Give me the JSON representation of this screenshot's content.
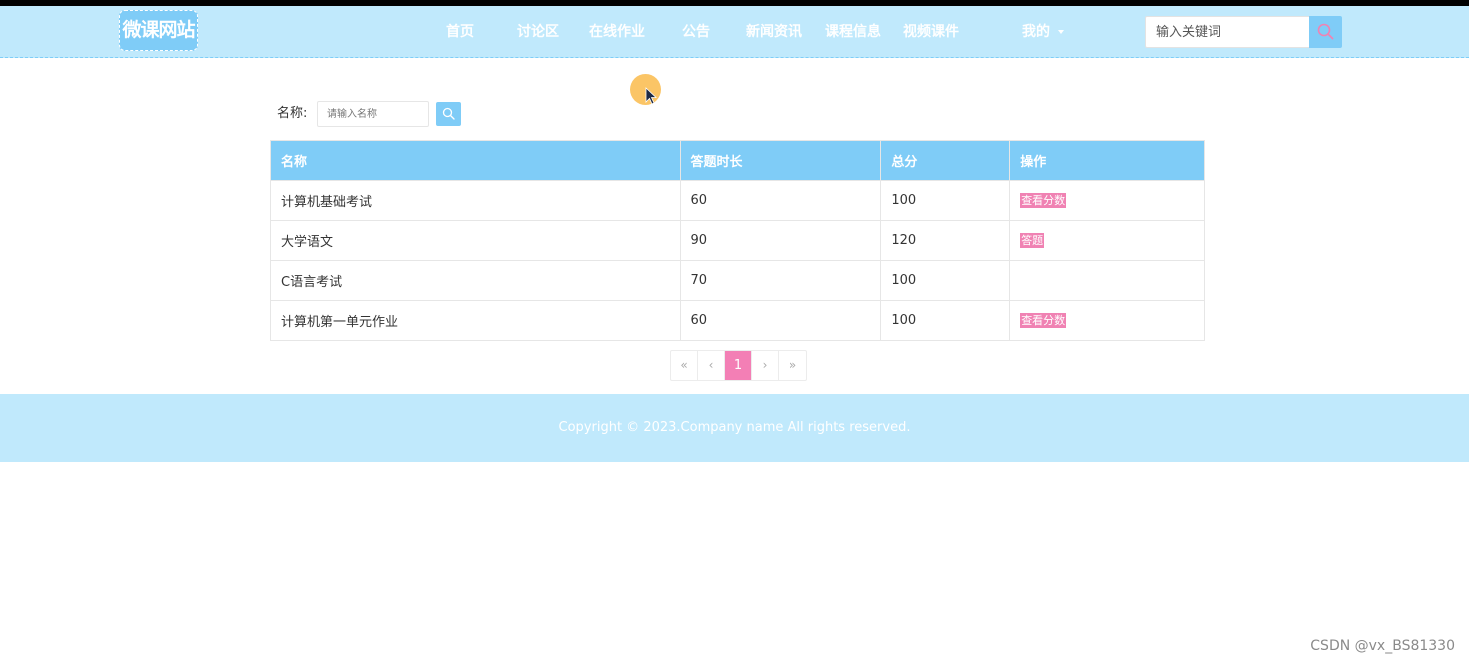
{
  "header": {
    "logo": "微课网站",
    "nav": [
      "首页",
      "讨论区",
      "在线作业",
      "公告",
      "新闻资讯",
      "课程信息",
      "视频课件"
    ],
    "user_menu": "我的",
    "search_placeholder": "输入关键词"
  },
  "filter": {
    "label": "名称:",
    "placeholder": "请输入名称"
  },
  "table": {
    "headers": [
      "名称",
      "答题时长",
      "总分",
      "操作"
    ],
    "rows": [
      {
        "name": "计算机基础考试",
        "duration": "60",
        "score": "100",
        "action": "查看分数"
      },
      {
        "name": "大学语文",
        "duration": "90",
        "score": "120",
        "action": "答题"
      },
      {
        "name": "C语言考试",
        "duration": "70",
        "score": "100",
        "action": ""
      },
      {
        "name": "计算机第一单元作业",
        "duration": "60",
        "score": "100",
        "action": "查看分数"
      }
    ]
  },
  "pagination": {
    "first": "«",
    "prev": "‹",
    "current": "1",
    "next": "›",
    "last": "»"
  },
  "footer": {
    "copyright": "Copyright © 2023.Company name All rights reserved."
  },
  "watermark": "CSDN @vx_BS81330",
  "colors": {
    "header_bg": "#c0e9fc",
    "accent_blue": "#7fccf7",
    "accent_pink": "#f082b3"
  },
  "icons": {
    "search": "search-icon",
    "dropdown": "caret-down-icon",
    "cursor": "mouse-pointer-icon"
  }
}
